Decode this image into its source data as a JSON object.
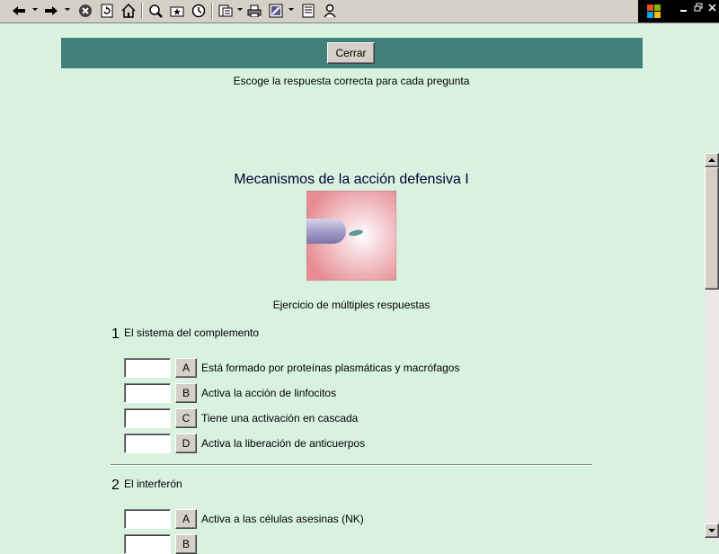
{
  "toolbar": {
    "icons": [
      "back-icon",
      "forward-icon",
      "stop-icon",
      "refresh-icon",
      "home-icon",
      "search-icon",
      "favorites-icon",
      "history-icon",
      "mail-icon",
      "print-icon",
      "edit-icon",
      "discuss-icon",
      "messenger-icon"
    ]
  },
  "header": {
    "close_label": "Cerrar"
  },
  "page": {
    "instructions": "Escoge la respuesta correcta para cada pregunta",
    "title": "Mecanismos de la acción defensiva I",
    "subtitle": "Ejercicio de múltiples respuestas"
  },
  "questions": [
    {
      "number": "1",
      "text": "El sistema del complemento",
      "options": [
        {
          "letter": "A",
          "text": "Está formado por proteínas plasmáticas y macrófagos",
          "value": ""
        },
        {
          "letter": "B",
          "text": "Activa la acción de linfocitos",
          "value": ""
        },
        {
          "letter": "C",
          "text": "Tiene una activación en cascada",
          "value": ""
        },
        {
          "letter": "D",
          "text": "Activa la liberación de anticuerpos",
          "value": ""
        }
      ]
    },
    {
      "number": "2",
      "text": "El interferón",
      "options": [
        {
          "letter": "A",
          "text": "Activa a las células asesinas (NK)",
          "value": ""
        },
        {
          "letter": "B",
          "text": "",
          "value": ""
        }
      ]
    }
  ],
  "colors": {
    "page_bg": "#d9f2e0",
    "header_bar": "#417f7a",
    "title_text": "#000033"
  }
}
